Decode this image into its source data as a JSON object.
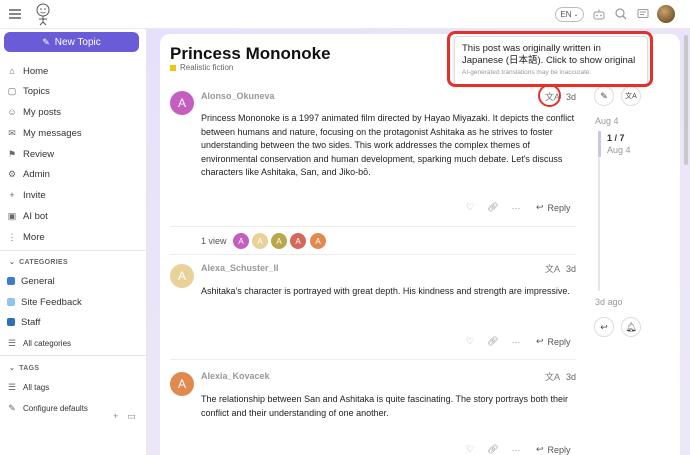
{
  "header": {
    "language": "EN",
    "user_avatar": "user-avatar"
  },
  "sidebar": {
    "new_topic": "New Topic",
    "nav": [
      {
        "label": "Home",
        "icon": "home-icon"
      },
      {
        "label": "Topics",
        "icon": "topics-icon"
      },
      {
        "label": "My posts",
        "icon": "user-icon"
      },
      {
        "label": "My messages",
        "icon": "inbox-icon"
      },
      {
        "label": "Review",
        "icon": "flag-icon"
      },
      {
        "label": "Admin",
        "icon": "wrench-icon"
      },
      {
        "label": "Invite",
        "icon": "invite-icon"
      },
      {
        "label": "AI bot",
        "icon": "bot-icon"
      },
      {
        "label": "More",
        "icon": "more-icon"
      }
    ],
    "categories_head": "CATEGORIES",
    "categories": [
      {
        "label": "General",
        "color": "#3a7fc1"
      },
      {
        "label": "Site Feedback",
        "color": "#8ec5e8"
      },
      {
        "label": "Staff",
        "color": "#2b6fb6"
      }
    ],
    "all_categories": "All categories",
    "tags_head": "TAGS",
    "all_tags": "All tags",
    "configure_defaults": "Configure defaults"
  },
  "topic": {
    "title": "Princess Mononoke",
    "category": "Realistic fiction"
  },
  "tooltip": {
    "line1": "This post was originally written in Japanese (日本語). Click to show original",
    "line2": "AI-generated translations may be inaccurate."
  },
  "posts": [
    {
      "initial": "A",
      "avatar_color": "#c45fc0",
      "username": "Alonso_Okuneva",
      "age": "3d",
      "text": "Princess Mononoke is a 1997 animated film directed by Hayao Miyazaki. It depicts the conflict between humans and nature, focusing on the protagonist Ashitaka as he strives to foster understanding between the two sides. This work addresses the complex themes of environmental conservation and human development, sparking much debate. Let's discuss characters like Ashitaka, San, and Jiko-bō.",
      "reply": "Reply"
    },
    {
      "initial": "A",
      "avatar_color": "#e8d29a",
      "username": "Alexa_Schuster_II",
      "age": "3d",
      "text": "Ashitaka's character is portrayed with great depth. His kindness and strength are impressive.",
      "reply": "Reply"
    },
    {
      "initial": "A",
      "avatar_color": "#e08a4f",
      "username": "Alexia_Kovacek",
      "age": "3d",
      "text": "The relationship between San and Ashitaka is quite fascinating. The story portrays both their conflict and their understanding of one another.",
      "reply": "Reply"
    }
  ],
  "views": {
    "label": "1 view",
    "avatars": [
      {
        "initial": "A",
        "color": "#c45fc0"
      },
      {
        "initial": "A",
        "color": "#e8d29a"
      },
      {
        "initial": "A",
        "color": "#b8a84a"
      },
      {
        "initial": "A",
        "color": "#d4685a"
      },
      {
        "initial": "A",
        "color": "#e08a4f"
      }
    ]
  },
  "timeline": {
    "start_date": "Aug 4",
    "position": "1 / 7",
    "position_date": "Aug 4",
    "end_label": "3d ago"
  }
}
